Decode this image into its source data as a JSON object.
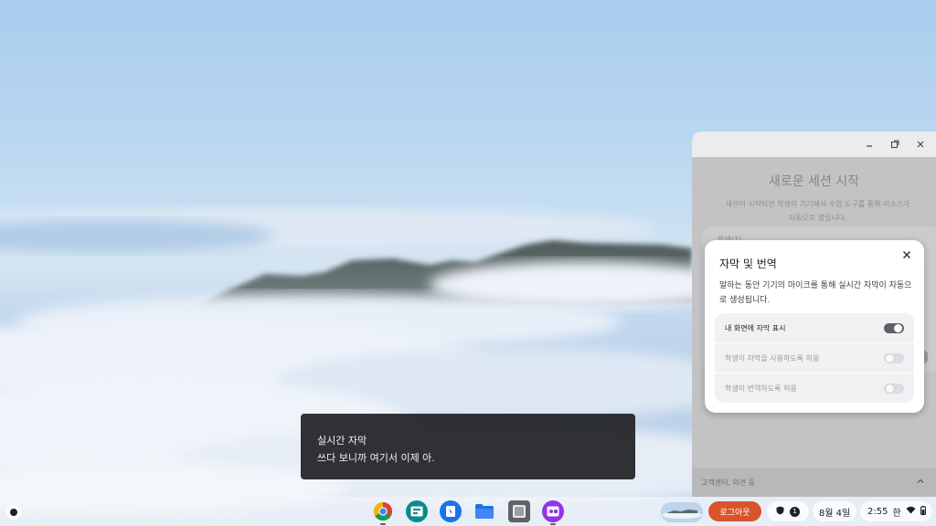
{
  "caption_bubble": {
    "title": "실시간 자막",
    "text": "쓰다 보니까 여기서 이제 아."
  },
  "side_panel": {
    "heading": "새로운 세션 시작",
    "description": "세션이 시작되면 학생의 기기에서 수업 도구를 통해 리소스가 자동으로 열립니다.",
    "students_label": "학생(3)",
    "footer_text": "고객센터, 의견 등",
    "window_controls": [
      "minimize-icon",
      "restore-icon",
      "close-icon"
    ]
  },
  "dialog": {
    "title": "자막 및 번역",
    "description": "말하는 동안 기기의 마이크를 통해 실시간 자막이 자동으로 생성됩니다.",
    "settings": [
      {
        "label": "내 화면에 자막 표시",
        "enabled": true
      },
      {
        "label": "학생이 자막을 사용하도록 허용",
        "enabled": false
      },
      {
        "label": "학생이 번역하도록 허용",
        "enabled": false
      }
    ]
  },
  "shelf": {
    "apps": [
      "chrome-icon",
      "classroom-tools-icon",
      "docs-app-icon",
      "files-icon",
      "settings-app-icon",
      "screencast-icon"
    ],
    "logout_label": "로그아웃",
    "notification_count": "1",
    "date": "8월 4일",
    "time": "2:55",
    "ime": "한",
    "colors": {
      "logout": "#d9542c",
      "toggle_on": "#5e6166"
    }
  }
}
